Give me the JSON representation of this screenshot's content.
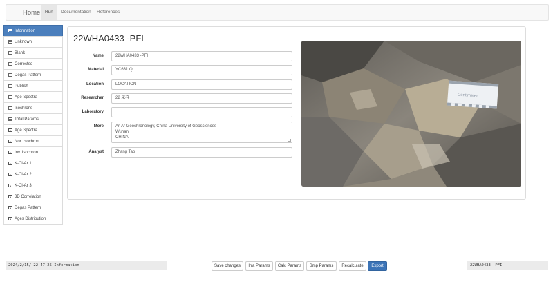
{
  "navbar": {
    "brand": "Home",
    "links": [
      {
        "label": "Run",
        "active": true
      },
      {
        "label": "Documentation",
        "active": false
      },
      {
        "label": "References",
        "active": false
      }
    ]
  },
  "sidebar": {
    "items": [
      {
        "label": "Information",
        "icon": "table-icon",
        "active": true
      },
      {
        "label": "Unknown",
        "icon": "table-icon"
      },
      {
        "label": "Blank",
        "icon": "table-icon"
      },
      {
        "label": "Corrected",
        "icon": "table-icon"
      },
      {
        "label": "Degas Pattern",
        "icon": "table-icon"
      },
      {
        "label": "Publish",
        "icon": "table-icon"
      },
      {
        "label": "Age Spectra",
        "icon": "table-icon"
      },
      {
        "label": "Isochrons",
        "icon": "table-icon"
      },
      {
        "label": "Total Params",
        "icon": "table-icon"
      },
      {
        "label": "Age Spectra",
        "icon": "image-icon"
      },
      {
        "label": "Nor. Isochron",
        "icon": "image-icon"
      },
      {
        "label": "Inv. Isochron",
        "icon": "image-icon"
      },
      {
        "label": "K-Cl-Ar 1",
        "icon": "image-icon"
      },
      {
        "label": "K-Cl-Ar 2",
        "icon": "image-icon"
      },
      {
        "label": "K-Cl-Ar 3",
        "icon": "image-icon"
      },
      {
        "label": "3D Correlation",
        "icon": "image-icon"
      },
      {
        "label": "Degas Pattern",
        "icon": "image-icon"
      },
      {
        "label": "Ages Distribution",
        "icon": "image-icon"
      }
    ]
  },
  "info": {
    "title": "22WHA0433 -PFI",
    "fields": {
      "name": {
        "label": "Name",
        "value": "22WHA0433 -PFI"
      },
      "material": {
        "label": "Material",
        "value": "YC631 Q"
      },
      "location": {
        "label": "Location",
        "value": "LOCATION"
      },
      "researcher": {
        "label": "Researcher",
        "value": "22 采样"
      },
      "laboratory": {
        "label": "Laboratory",
        "value": ""
      },
      "more": {
        "label": "More",
        "value": "Ar-Ar Geochronology, China University of Geosciences\nWuhan\nCHINA"
      },
      "analyst": {
        "label": "Analyst",
        "value": "Zhang Tao"
      }
    },
    "photo_card_text": "Centimeter"
  },
  "footer": {
    "status_left": "2024/2/15/ 22:47:25 Information",
    "status_right": "22WHA0433 -PFI",
    "buttons": {
      "save": "Save changes",
      "irra": "Irra Params",
      "calc": "Calc Params",
      "smp": "Smp Params",
      "recalc": "Recalculate",
      "export": "Export"
    }
  },
  "colors": {
    "accent": "#4b7fbd",
    "export_button": "#3c74b7"
  }
}
